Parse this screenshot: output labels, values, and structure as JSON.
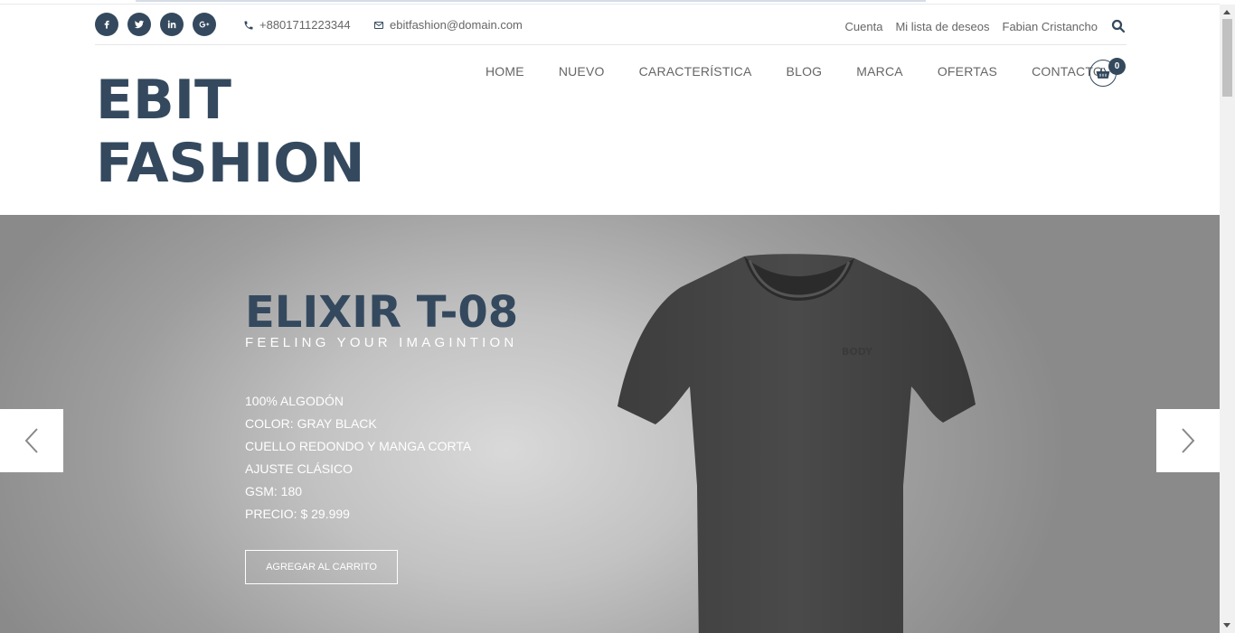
{
  "topbar": {
    "social": [
      {
        "icon": "facebook-icon",
        "label": "f"
      },
      {
        "icon": "twitter-icon",
        "label": "t"
      },
      {
        "icon": "linkedin-icon",
        "label": "in"
      },
      {
        "icon": "google-plus-icon",
        "label": "g+"
      }
    ],
    "phone": "+8801711223344",
    "email": "ebitfashion@domain.com",
    "links": [
      "Cuenta",
      "Mi lista de deseos",
      "Fabian Cristancho"
    ]
  },
  "header": {
    "logo_line1": "EBIT",
    "logo_line2": "FASHION",
    "nav": [
      "HOME",
      "NUEVO",
      "CARACTERÍSTICA",
      "BLOG",
      "MARCA",
      "OFERTAS",
      "CONTACTO"
    ],
    "cart_count": "0"
  },
  "hero": {
    "title": "ELIXIR T-08",
    "subtitle": "FEELING YOUR IMAGINTION",
    "features": [
      "100% ALGODÓN",
      "COLOR: GRAY BLACK",
      "CUELLO REDONDO Y MANGA CORTA",
      "AJUSTE CLÁSICO",
      "GSM: 180",
      "PRECIO: $ 29.999"
    ],
    "button": "AGREGAR AL CARRITO"
  },
  "colors": {
    "brand": "#34495e",
    "text_muted": "#666666"
  }
}
